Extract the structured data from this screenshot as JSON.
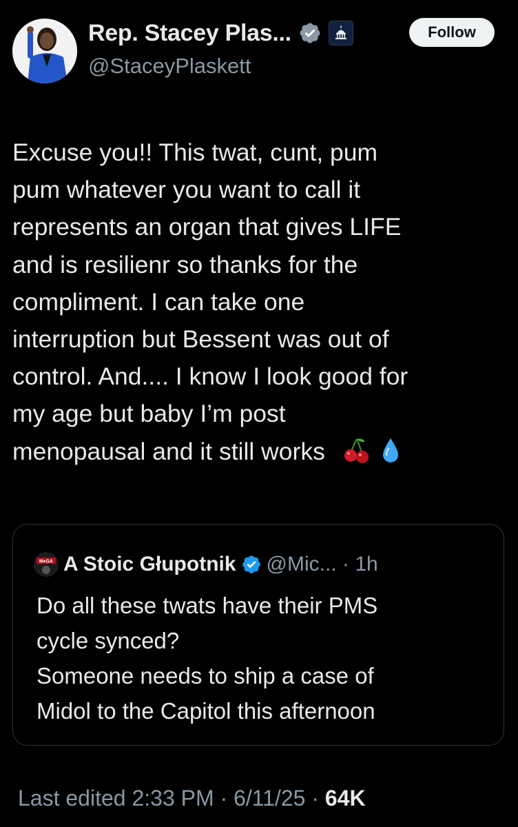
{
  "author": {
    "display_name": "Rep. Stacey Plas...",
    "handle": "@StaceyPlaskett",
    "verified_icon": "verified-badge-icon",
    "affiliation_icon": "capitol-dome-icon"
  },
  "follow_label": "Follow",
  "tweet": {
    "lines": [
      "Excuse you!! This twat, cunt, pum",
      "pum whatever you want to call it",
      "represents an organ that gives LIFE",
      "and is resilienr  so thanks for the",
      "compliment. I can take one",
      "interruption but Bessent was out of",
      "control. And.... I know I look good for",
      "my age but baby I’m post",
      "menopausal and it still works"
    ],
    "emojis": [
      "cherries-icon",
      "droplet-icon"
    ]
  },
  "quote": {
    "name": "A Stoic Głupotnik",
    "handle_time": "@Mic... · 1h",
    "lines": [
      "Do all these twats have their PMS",
      "cycle synced?",
      "Someone needs to ship a case of",
      "Midol to the Capitol this afternoon"
    ]
  },
  "meta": {
    "edited": "Last edited 2:33 PM · 6/11/25 ·",
    "views": "64K"
  },
  "colors": {
    "background": "#000000",
    "text": "#e7e9ea",
    "secondary": "#8b98a5",
    "verified_blue": "#1d9bf0",
    "border": "#2f3336"
  }
}
